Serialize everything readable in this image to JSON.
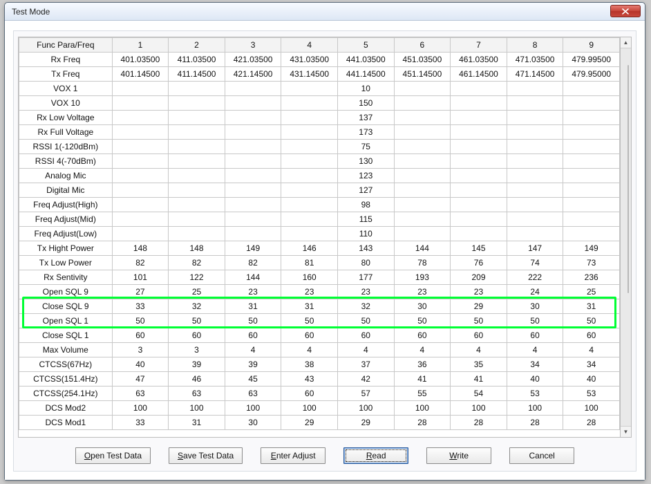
{
  "window": {
    "title": "Test Mode"
  },
  "table": {
    "header_label": "Func Para/Freq",
    "columns": [
      "1",
      "2",
      "3",
      "4",
      "5",
      "6",
      "7",
      "8",
      "9"
    ],
    "rows": [
      {
        "label": "Rx Freq",
        "values": [
          "401.03500",
          "411.03500",
          "421.03500",
          "431.03500",
          "441.03500",
          "451.03500",
          "461.03500",
          "471.03500",
          "479.99500"
        ]
      },
      {
        "label": "Tx Freq",
        "values": [
          "401.14500",
          "411.14500",
          "421.14500",
          "431.14500",
          "441.14500",
          "451.14500",
          "461.14500",
          "471.14500",
          "479.95000"
        ]
      },
      {
        "label": "VOX 1",
        "values": [
          "",
          "",
          "",
          "",
          "10",
          "",
          "",
          "",
          ""
        ]
      },
      {
        "label": "VOX 10",
        "values": [
          "",
          "",
          "",
          "",
          "150",
          "",
          "",
          "",
          ""
        ]
      },
      {
        "label": "Rx Low Voltage",
        "values": [
          "",
          "",
          "",
          "",
          "137",
          "",
          "",
          "",
          ""
        ]
      },
      {
        "label": "Rx Full Voltage",
        "values": [
          "",
          "",
          "",
          "",
          "173",
          "",
          "",
          "",
          ""
        ]
      },
      {
        "label": "RSSI 1(-120dBm)",
        "values": [
          "",
          "",
          "",
          "",
          "75",
          "",
          "",
          "",
          ""
        ]
      },
      {
        "label": "RSSI 4(-70dBm)",
        "values": [
          "",
          "",
          "",
          "",
          "130",
          "",
          "",
          "",
          ""
        ]
      },
      {
        "label": "Analog Mic",
        "values": [
          "",
          "",
          "",
          "",
          "123",
          "",
          "",
          "",
          ""
        ]
      },
      {
        "label": "Digital Mic",
        "values": [
          "",
          "",
          "",
          "",
          "127",
          "",
          "",
          "",
          ""
        ]
      },
      {
        "label": "Freq Adjust(High)",
        "values": [
          "",
          "",
          "",
          "",
          "98",
          "",
          "",
          "",
          ""
        ]
      },
      {
        "label": "Freq Adjust(Mid)",
        "values": [
          "",
          "",
          "",
          "",
          "115",
          "",
          "",
          "",
          ""
        ]
      },
      {
        "label": "Freq Adjust(Low)",
        "values": [
          "",
          "",
          "",
          "",
          "110",
          "",
          "",
          "",
          ""
        ]
      },
      {
        "label": "Tx Hight Power",
        "values": [
          "148",
          "148",
          "149",
          "146",
          "143",
          "144",
          "145",
          "147",
          "149"
        ]
      },
      {
        "label": "Tx Low Power",
        "values": [
          "82",
          "82",
          "82",
          "81",
          "80",
          "78",
          "76",
          "74",
          "73"
        ]
      },
      {
        "label": "Rx Sentivity",
        "values": [
          "101",
          "122",
          "144",
          "160",
          "177",
          "193",
          "209",
          "222",
          "236"
        ]
      },
      {
        "label": "Open SQL 9",
        "values": [
          "27",
          "25",
          "23",
          "23",
          "23",
          "23",
          "23",
          "24",
          "25"
        ]
      },
      {
        "label": "Close SQL 9",
        "values": [
          "33",
          "32",
          "31",
          "31",
          "32",
          "30",
          "29",
          "30",
          "31"
        ]
      },
      {
        "label": "Open SQL 1",
        "values": [
          "50",
          "50",
          "50",
          "50",
          "50",
          "50",
          "50",
          "50",
          "50"
        ]
      },
      {
        "label": "Close SQL 1",
        "values": [
          "60",
          "60",
          "60",
          "60",
          "60",
          "60",
          "60",
          "60",
          "60"
        ]
      },
      {
        "label": "Max Volume",
        "values": [
          "3",
          "3",
          "4",
          "4",
          "4",
          "4",
          "4",
          "4",
          "4"
        ]
      },
      {
        "label": "CTCSS(67Hz)",
        "values": [
          "40",
          "39",
          "39",
          "38",
          "37",
          "36",
          "35",
          "34",
          "34"
        ]
      },
      {
        "label": "CTCSS(151.4Hz)",
        "values": [
          "47",
          "46",
          "45",
          "43",
          "42",
          "41",
          "41",
          "40",
          "40"
        ]
      },
      {
        "label": "CTCSS(254.1Hz)",
        "values": [
          "63",
          "63",
          "63",
          "60",
          "57",
          "55",
          "54",
          "53",
          "53"
        ]
      },
      {
        "label": "DCS Mod2",
        "values": [
          "100",
          "100",
          "100",
          "100",
          "100",
          "100",
          "100",
          "100",
          "100"
        ]
      },
      {
        "label": "DCS Mod1",
        "values": [
          "33",
          "31",
          "30",
          "29",
          "29",
          "28",
          "28",
          "28",
          "28"
        ]
      }
    ]
  },
  "buttons": {
    "open": {
      "mn": "O",
      "rest": "pen Test Data"
    },
    "save": {
      "mn": "S",
      "rest": "ave Test Data"
    },
    "enter": {
      "mn": "E",
      "rest": "nter Adjust"
    },
    "read": {
      "mn": "R",
      "rest": "ead"
    },
    "write": {
      "mn": "W",
      "rest": "rite"
    },
    "cancel": {
      "text": "Cancel"
    }
  }
}
